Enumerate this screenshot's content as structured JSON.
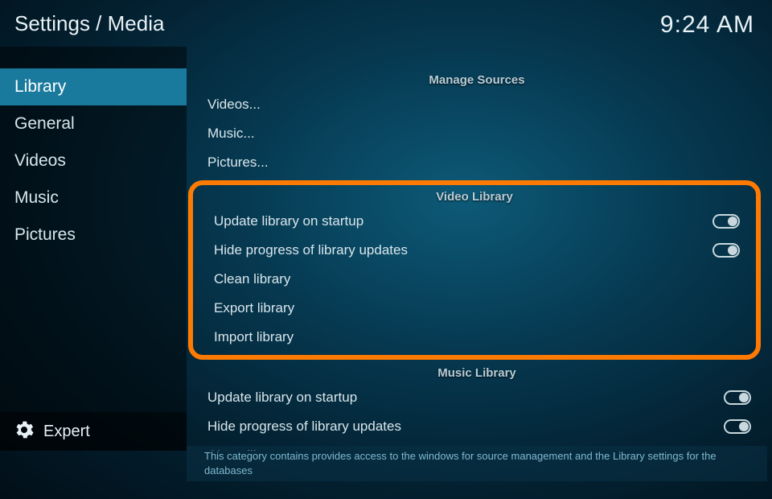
{
  "header": {
    "breadcrumb": "Settings / Media",
    "clock": "9:24 AM"
  },
  "sidebar": {
    "items": [
      {
        "label": "Library",
        "selected": true
      },
      {
        "label": "General",
        "selected": false
      },
      {
        "label": "Videos",
        "selected": false
      },
      {
        "label": "Music",
        "selected": false
      },
      {
        "label": "Pictures",
        "selected": false
      }
    ]
  },
  "level": {
    "label": "Expert"
  },
  "content": {
    "sections": [
      {
        "title": "Manage Sources",
        "highlighted": false,
        "rows": [
          {
            "label": "Videos...",
            "type": "link"
          },
          {
            "label": "Music...",
            "type": "link"
          },
          {
            "label": "Pictures...",
            "type": "link"
          }
        ]
      },
      {
        "title": "Video Library",
        "highlighted": true,
        "rows": [
          {
            "label": "Update library on startup",
            "type": "toggle",
            "value": false
          },
          {
            "label": "Hide progress of library updates",
            "type": "toggle",
            "value": false
          },
          {
            "label": "Clean library",
            "type": "link"
          },
          {
            "label": "Export library",
            "type": "link"
          },
          {
            "label": "Import library",
            "type": "link"
          }
        ]
      },
      {
        "title": "Music Library",
        "highlighted": false,
        "rows": [
          {
            "label": "Update library on startup",
            "type": "toggle",
            "value": false
          },
          {
            "label": "Hide progress of library updates",
            "type": "toggle",
            "value": false
          },
          {
            "label": "Clean library",
            "type": "link",
            "cut": true
          }
        ]
      }
    ]
  },
  "description": "This category contains provides access to the windows for source management and the Library settings for the databases"
}
